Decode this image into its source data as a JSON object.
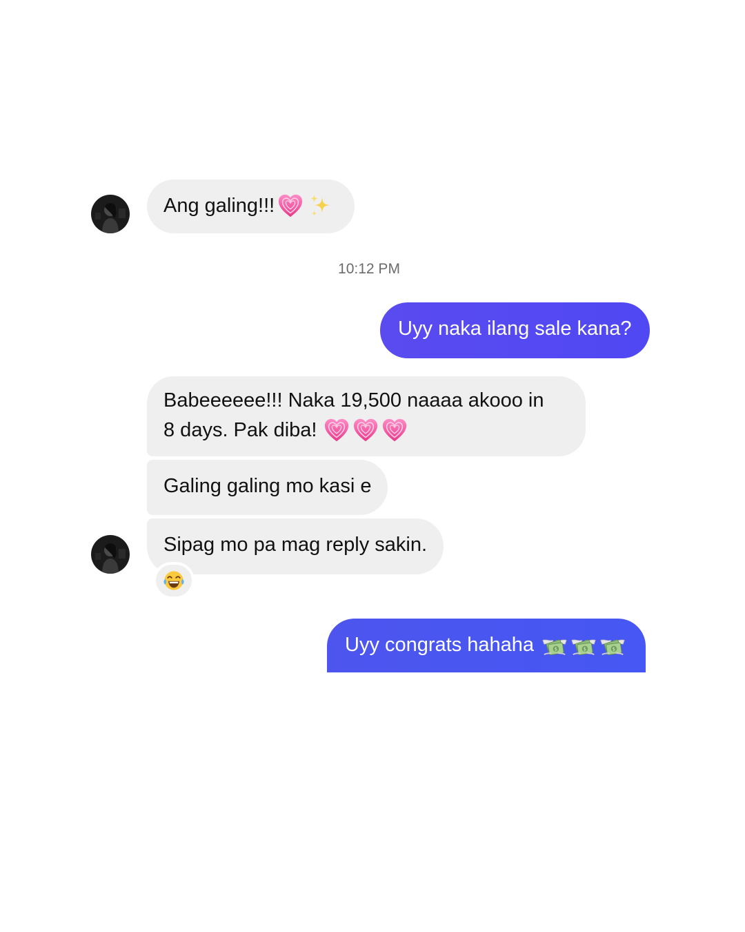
{
  "conversation": {
    "contact_avatar": "contact-avatar-photo",
    "timestamp": "10:12 PM",
    "messages": [
      {
        "sender": "contact",
        "text": "Ang galing!!!",
        "emojis": [
          "growing-heart-emoji",
          "sparkles-emoji"
        ]
      },
      {
        "sender": "me",
        "text": "Uyy naka ilang sale kana?"
      },
      {
        "sender": "contact",
        "line1": "Babeeeeee!!! Naka 19,500 naaaa akooo in",
        "line2": "8 days. Pak diba!",
        "emojis": [
          "growing-heart-emoji",
          "growing-heart-emoji",
          "growing-heart-emoji"
        ]
      },
      {
        "sender": "contact",
        "text": "Galing galing mo kasi e"
      },
      {
        "sender": "contact",
        "text": "Sipag mo pa mag reply sakin.",
        "reaction": "tears-of-joy-emoji"
      },
      {
        "sender": "me",
        "text": "Uyy congrats hahaha",
        "emojis": [
          "money-with-wings-emoji",
          "money-with-wings-emoji",
          "money-with-wings-emoji"
        ]
      }
    ]
  },
  "colors": {
    "incoming_bubble": "#efefef",
    "outgoing_gradient_start": "#5a4bf0",
    "outgoing_gradient_end": "#4a55f2",
    "timestamp_text": "#6b6b6b",
    "heart_pink": "#f25aa0"
  }
}
